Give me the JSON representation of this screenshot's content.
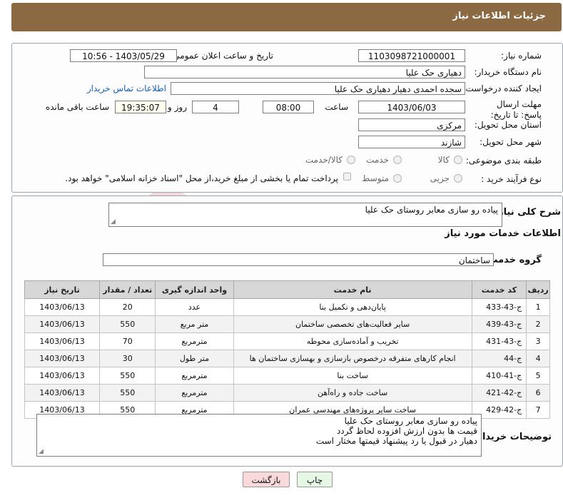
{
  "header": {
    "title": "جزئیات اطلاعات نیاز"
  },
  "form": {
    "need_number_label": "شماره نیاز:",
    "need_number": "1103098721000001",
    "announce_label": "تاریخ و ساعت اعلان عمومی:",
    "announce_value": "1403/05/29 - 10:56",
    "buyer_org_label": "نام دستگاه خریدار:",
    "buyer_org": "دهیاری حک علیا",
    "creator_label": "ایجاد کننده درخواست:",
    "creator": "سجده احمدی دهیار دهیاری حک علیا",
    "contact_link": "اطلاعات تماس خریدار",
    "deadline_label": "مهلت ارسال پاسخ: تا تاریخ:",
    "deadline_date": "1403/06/03",
    "time_label": "ساعت",
    "deadline_time": "08:00",
    "days": "4",
    "days_label": "روز و",
    "remaining_time": "19:35:07",
    "remaining_label": "ساعت باقی مانده",
    "province_label": "استان محل تحویل:",
    "province": "مرکزی",
    "city_label": "شهر محل تحویل:",
    "city": "شازند",
    "category_label": "طبقه بندی موضوعی:",
    "category_options": [
      "کالا",
      "خدمت",
      "کالا/خدمت"
    ],
    "process_label": "نوع فرآیند خرید :",
    "process_options": [
      "جزیی",
      "متوسط"
    ],
    "payment_note": "پرداخت تمام یا بخشی از مبلغ خرید،از محل \"اسناد خزانه اسلامی\" خواهد بود."
  },
  "summary": {
    "label": "شرح کلی نیاز:",
    "value": "پیاده رو سازی معابر روستای حک علیا"
  },
  "services": {
    "title": "اطلاعات خدمات مورد نیاز",
    "group_label": "گروه خدمت:",
    "group_value": "ساختمان",
    "columns": [
      "ردیف",
      "کد خدمت",
      "نام خدمت",
      "واحد اندازه گیری",
      "تعداد / مقدار",
      "تاریخ نیاز"
    ],
    "rows": [
      [
        "1",
        "ج-43-433",
        "پایان‌دهی و تکمیل بنا",
        "عدد",
        "20",
        "1403/06/13"
      ],
      [
        "2",
        "ج-43-439",
        "سایر فعالیت‌های تخصصی ساختمان",
        "متر مربع",
        "550",
        "1403/06/13"
      ],
      [
        "3",
        "ج-43-431",
        "تخریب و آماده‌سازی محوطه",
        "مترمربع",
        "70",
        "1403/06/13"
      ],
      [
        "4",
        "ج-44",
        "انجام کارهای متفرقه درخصوص بازسازی و بهسازی ساختمان ها",
        "متر طول",
        "30",
        "1403/06/13"
      ],
      [
        "5",
        "ج-41-410",
        "ساخت بنا",
        "مترمربع",
        "550",
        "1403/06/13"
      ],
      [
        "6",
        "ج-42-421",
        "ساخت جاده و راه‌آهن",
        "مترمربع",
        "550",
        "1403/06/13"
      ],
      [
        "7",
        "ج-42-429",
        "ساخت سایر پروژه‌های مهندسی عمران",
        "مترمربع",
        "550",
        "1403/06/13"
      ]
    ]
  },
  "buyer_notes": {
    "label": "توضیحات خریدار:",
    "lines": [
      "پیاده رو سازی معابر روستای حک علیا",
      "قیمت ها بدون ارزش افزوده لحاظ گردد",
      "دهیار در قبول یا رد پیشنهاد قیمتها مختار است"
    ]
  },
  "buttons": {
    "print": "چاپ",
    "back": "بازگشت"
  },
  "watermark": {
    "text": "AriaTender.neT"
  },
  "colors": {
    "header": "#8b6a43",
    "back_button": "#f9d9d9",
    "print_button": "#e6f7e6",
    "link": "#1a5fb4"
  }
}
